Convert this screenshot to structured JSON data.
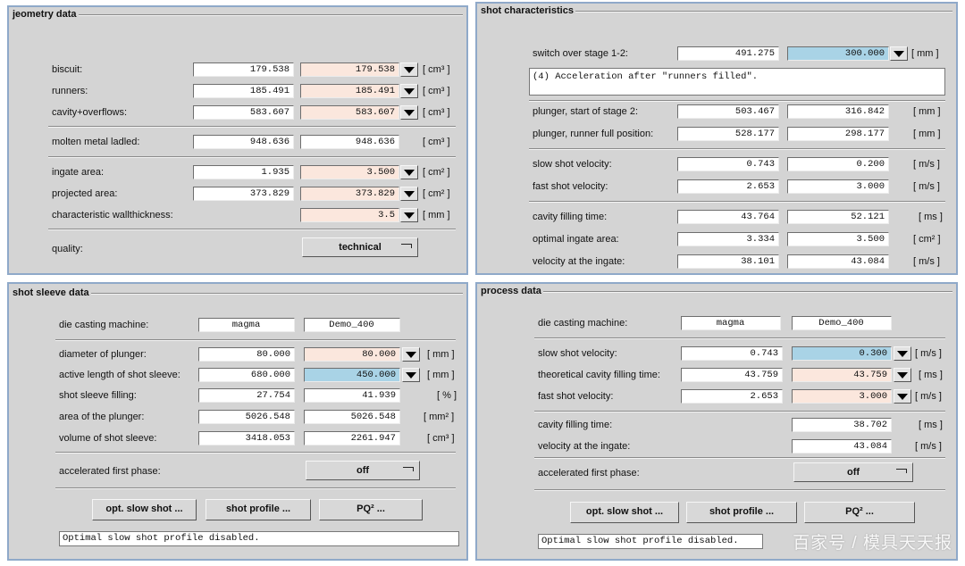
{
  "geometry": {
    "title": "jeometry data",
    "rows": [
      {
        "label": "biscuit:",
        "v1": "179.538",
        "v2": "179.538",
        "unit": "[ cm³ ]"
      },
      {
        "label": "runners:",
        "v1": "185.491",
        "v2": "185.491",
        "unit": "[ cm³ ]"
      },
      {
        "label": "cavity+overflows:",
        "v1": "583.607",
        "v2": "583.607",
        "unit": "[ cm³ ]"
      },
      {
        "label": "molten metal ladled:",
        "v1": "948.636",
        "v2": "948.636",
        "unit": "[ cm³ ]"
      },
      {
        "label": "ingate area:",
        "v1": "1.935",
        "v2": "3.500",
        "unit": "[ cm² ]"
      },
      {
        "label": "projected area:",
        "v1": "373.829",
        "v2": "373.829",
        "unit": "[ cm² ]"
      },
      {
        "label": "characteristic wallthickness:",
        "v2": "3.5",
        "unit": "[ mm ]"
      }
    ],
    "quality_label": "quality:",
    "quality_value": "technical"
  },
  "shot": {
    "title": "shot characteristics",
    "switch_label": "switch over stage 1-2:",
    "switch_v1": "491.275",
    "switch_v2": "300.000",
    "switch_unit": "[ mm ]",
    "message": "(4) Acceleration after \"runners filled\".",
    "rows": [
      {
        "label": "plunger, start of stage 2:",
        "v1": "503.467",
        "v2": "316.842",
        "unit": "[ mm ]"
      },
      {
        "label": "plunger, runner full position:",
        "v1": "528.177",
        "v2": "298.177",
        "unit": "[ mm ]"
      },
      {
        "label": "slow shot velocity:",
        "v1": "0.743",
        "v2": "0.200",
        "unit": "[ m/s ]"
      },
      {
        "label": "fast shot velocity:",
        "v1": "2.653",
        "v2": "3.000",
        "unit": "[ m/s ]"
      },
      {
        "label": "cavity filling time:",
        "v1": "43.764",
        "v2": "52.121",
        "unit": "[ ms ]"
      },
      {
        "label": "optimal ingate area:",
        "v1": "3.334",
        "v2": "3.500",
        "unit": "[ cm² ]"
      },
      {
        "label": "velocity at the ingate:",
        "v1": "38.101",
        "v2": "43.084",
        "unit": "[ m/s ]"
      }
    ]
  },
  "sleeve": {
    "title": "shot sleeve data",
    "machine_label": "die casting machine:",
    "machine_v1": "magma",
    "machine_v2": "Demo_400",
    "rows": [
      {
        "label": "diameter of plunger:",
        "v1": "80.000",
        "v2": "80.000",
        "unit": "[ mm ]"
      },
      {
        "label": "active length of shot sleeve:",
        "v1": "680.000",
        "v2": "450.000",
        "unit": "[ mm ]"
      },
      {
        "label": "shot sleeve filling:",
        "v1": "27.754",
        "v2": "41.939",
        "unit": "[ % ]"
      },
      {
        "label": "area of the plunger:",
        "v1": "5026.548",
        "v2": "5026.548",
        "unit": "[ mm² ]"
      },
      {
        "label": "volume of shot sleeve:",
        "v1": "3418.053",
        "v2": "2261.947",
        "unit": "[ cm³ ]"
      }
    ],
    "accel_label": "accelerated first phase:",
    "accel_value": "off",
    "buttons": [
      "opt. slow shot ...",
      "shot profile ...",
      "PQ² ..."
    ],
    "status": "Optimal slow shot profile disabled."
  },
  "process": {
    "title": "process data",
    "machine_label": "die casting machine:",
    "machine_v1": "magma",
    "machine_v2": "Demo_400",
    "rows": [
      {
        "label": "slow shot velocity:",
        "v1": "0.743",
        "v2": "0.300",
        "unit": "[ m/s ]"
      },
      {
        "label": "theoretical cavity filling time:",
        "v1": "43.759",
        "v2": "43.759",
        "unit": "[ ms ]"
      },
      {
        "label": "fast shot velocity:",
        "v1": "2.653",
        "v2": "3.000",
        "unit": "[ m/s ]"
      },
      {
        "label": "cavity filling time:",
        "v2": "38.702",
        "unit": "[ ms ]"
      },
      {
        "label": "velocity at the ingate:",
        "v2": "43.084",
        "unit": "[ m/s ]"
      }
    ],
    "accel_label": "accelerated first phase:",
    "accel_value": "off",
    "buttons": [
      "opt. slow shot ...",
      "shot profile ...",
      "PQ² ..."
    ],
    "status": "Optimal slow shot profile disabled.",
    "watermark": "百家号 / 模具天天报"
  },
  "colors": {
    "panel_bg": "#d4d4d4",
    "panel_border": "#8fa9c9",
    "edited_field": "#fbe7dd",
    "selected_field": "#a9d3e6"
  }
}
